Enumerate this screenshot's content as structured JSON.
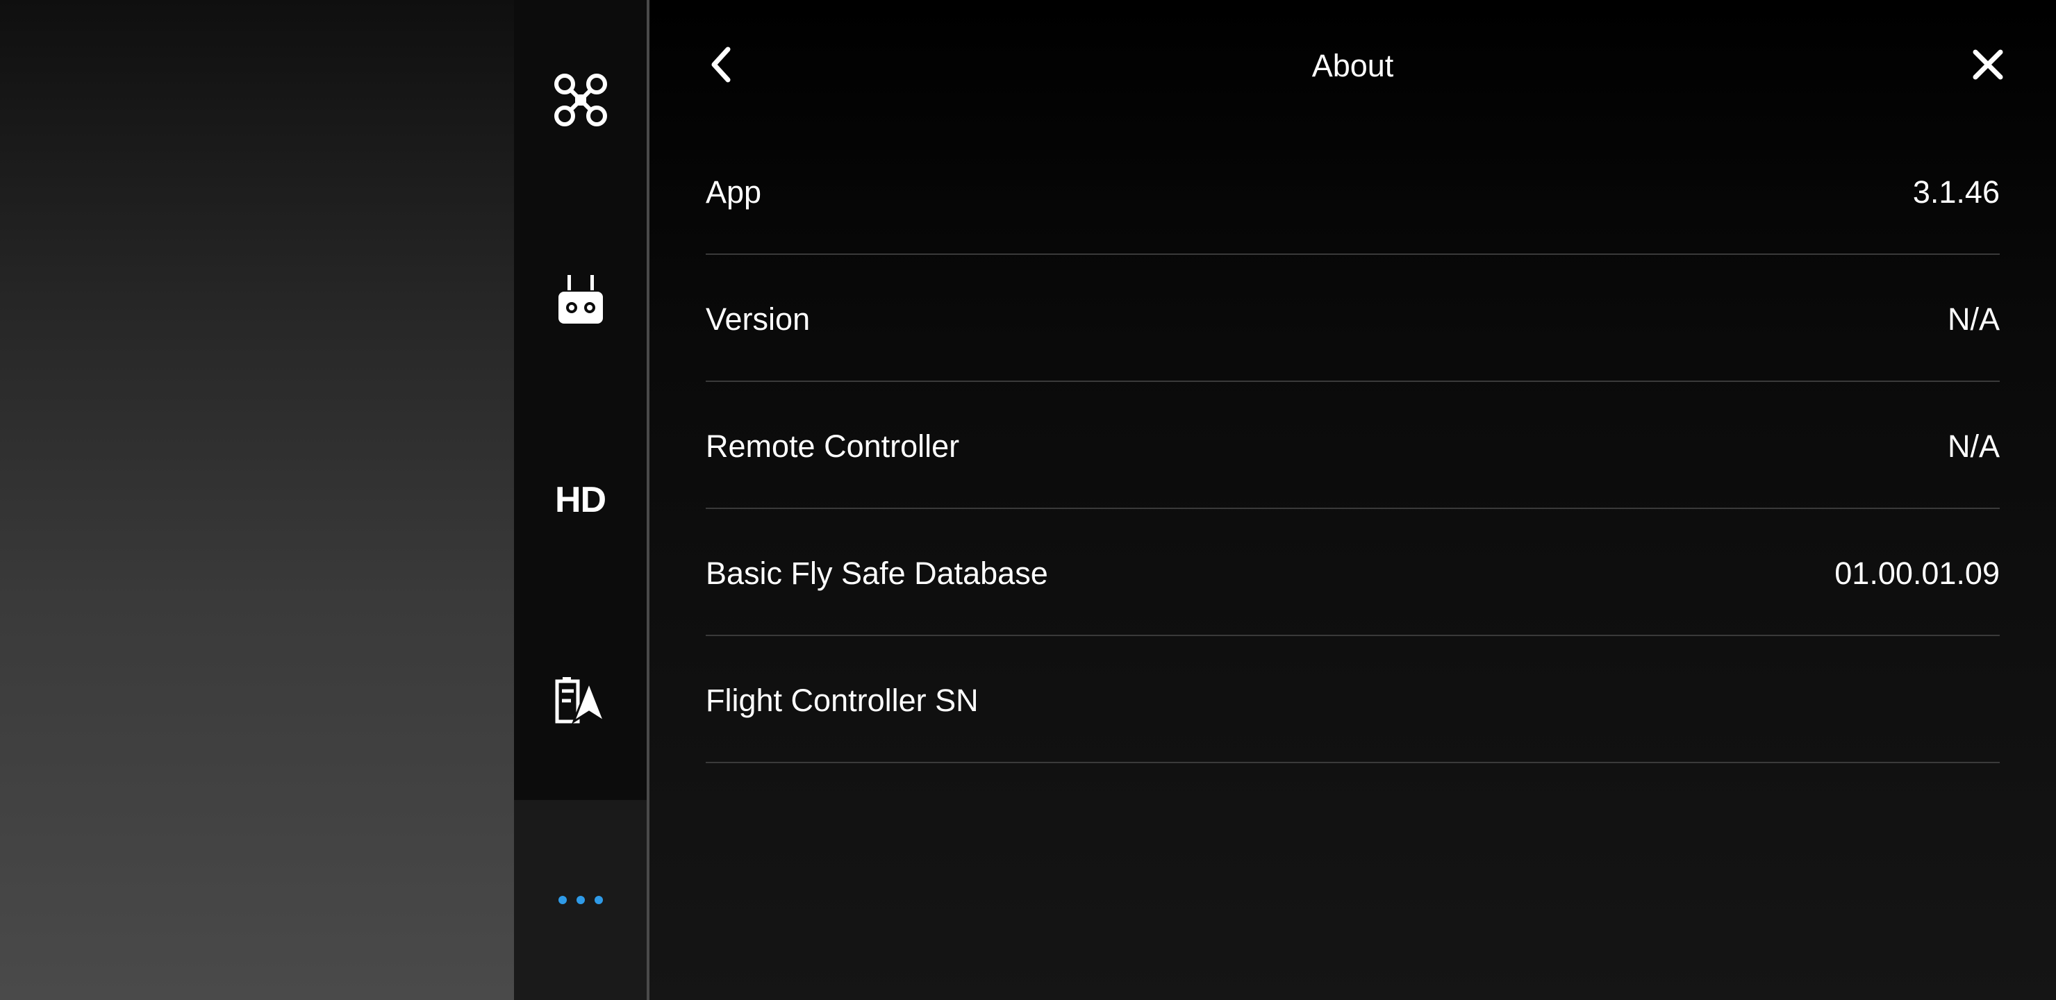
{
  "header": {
    "title": "About"
  },
  "sidebar": {
    "items": [
      {
        "icon": "aircraft-icon"
      },
      {
        "icon": "remote-controller-icon"
      },
      {
        "icon": "hd-icon",
        "label": "HD"
      },
      {
        "icon": "flight-battery-icon"
      },
      {
        "icon": "more-dots-icon",
        "active": true
      }
    ]
  },
  "about": {
    "rows": [
      {
        "label": "App",
        "value": "3.1.46"
      },
      {
        "label": "Version",
        "value": "N/A"
      },
      {
        "label": "Remote Controller",
        "value": "N/A"
      },
      {
        "label": "Basic Fly Safe Database",
        "value": "01.00.01.09"
      },
      {
        "label": "Flight Controller SN",
        "value": ""
      }
    ]
  },
  "colors": {
    "accent": "#2f9be8",
    "divider": "#3a3a3a"
  }
}
